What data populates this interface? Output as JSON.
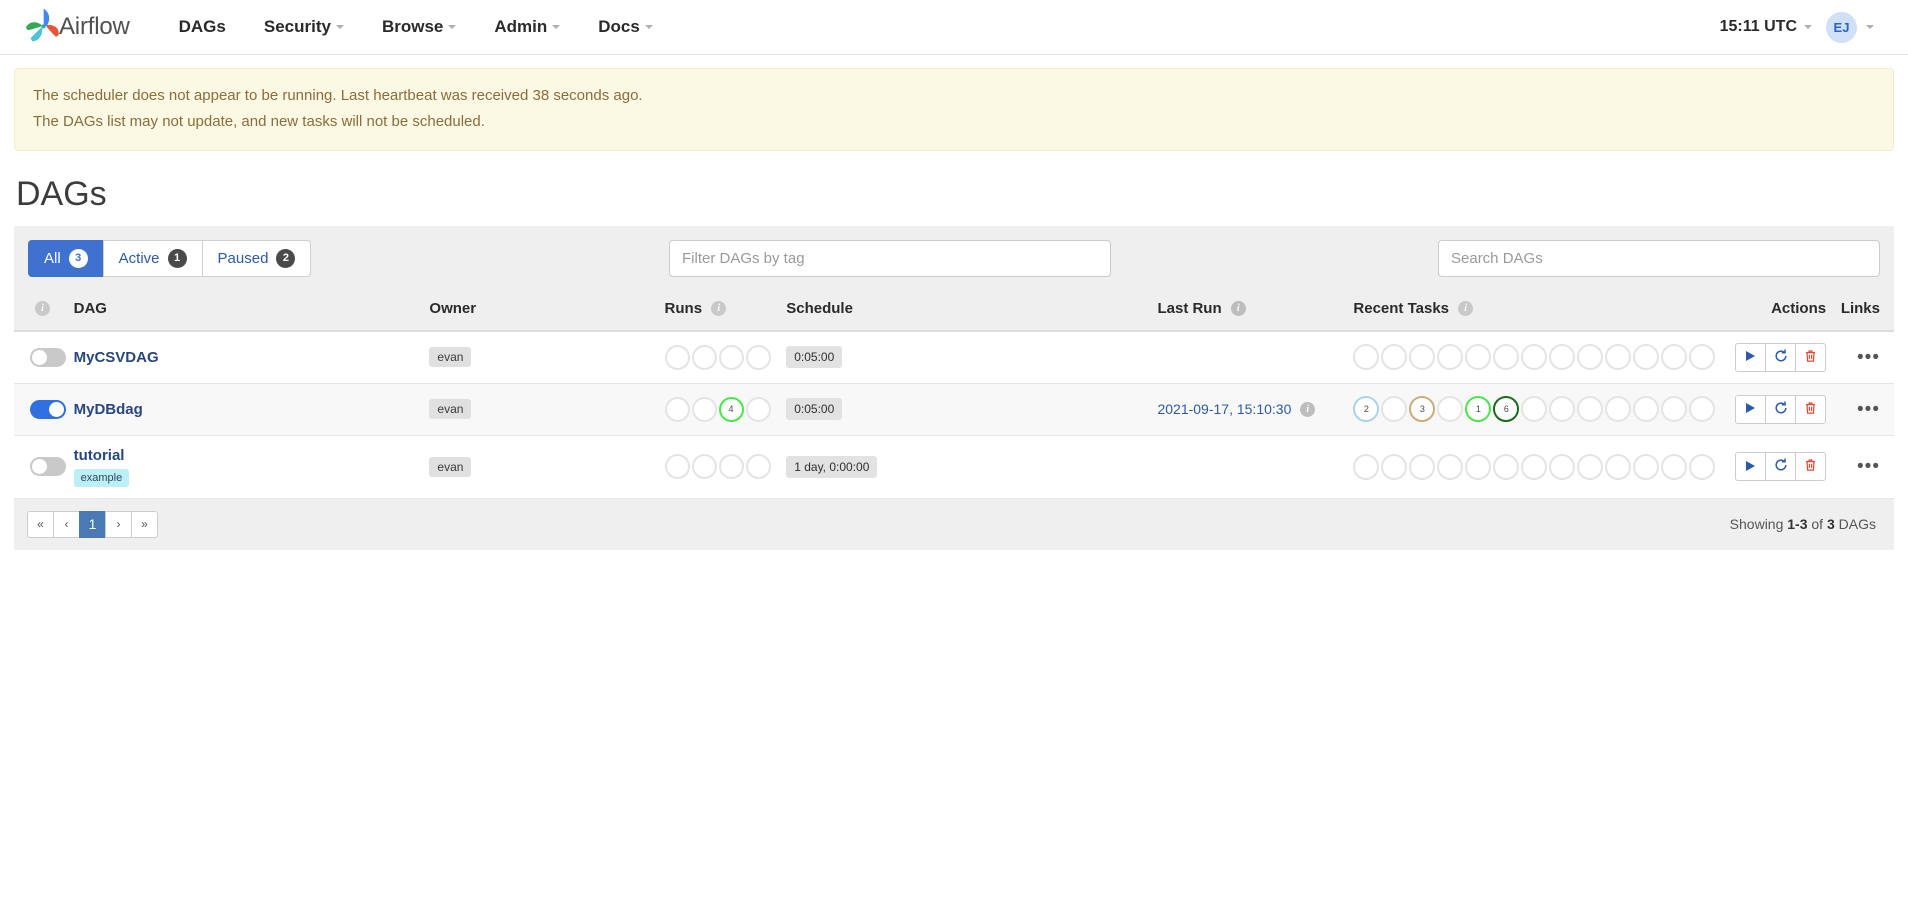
{
  "navbar": {
    "brand": "Airflow",
    "brand_logo_icon": "airflow-pinwheel-logo",
    "links": [
      {
        "label": "DAGs",
        "has_caret": false
      },
      {
        "label": "Security",
        "has_caret": true
      },
      {
        "label": "Browse",
        "has_caret": true
      },
      {
        "label": "Admin",
        "has_caret": true
      },
      {
        "label": "Docs",
        "has_caret": true
      }
    ],
    "clock": "15:11 UTC",
    "avatar_initials": "EJ"
  },
  "alert": {
    "line1": "The scheduler does not appear to be running. Last heartbeat was received 38 seconds ago.",
    "line2": "The DAGs list may not update, and new tasks will not be scheduled."
  },
  "page": {
    "title": "DAGs"
  },
  "filters": {
    "tabs": [
      {
        "label": "All",
        "count": "3",
        "active": true
      },
      {
        "label": "Active",
        "count": "1",
        "active": false
      },
      {
        "label": "Paused",
        "count": "2",
        "active": false
      }
    ],
    "tag_placeholder": "Filter DAGs by tag",
    "tag_value": "",
    "search_placeholder": "Search DAGs",
    "search_value": ""
  },
  "table": {
    "headers": {
      "toggle": "",
      "dag": "DAG",
      "owner": "Owner",
      "runs": "Runs",
      "schedule": "Schedule",
      "last_run": "Last Run",
      "recent_tasks": "Recent Tasks",
      "actions": "Actions",
      "links": "Links"
    },
    "rows": [
      {
        "name": "MyCSVDAG",
        "tag": "",
        "paused": true,
        "owner": "evan",
        "schedule": "0:05:00",
        "last_run": "",
        "runs": [
          {
            "count": "",
            "state": "none"
          },
          {
            "count": "",
            "state": "none"
          },
          {
            "count": "",
            "state": "none"
          },
          {
            "count": "",
            "state": "none"
          }
        ],
        "recent_tasks": [
          {
            "count": "",
            "state": "none"
          },
          {
            "count": "",
            "state": "none"
          },
          {
            "count": "",
            "state": "none"
          },
          {
            "count": "",
            "state": "none"
          },
          {
            "count": "",
            "state": "none"
          },
          {
            "count": "",
            "state": "none"
          },
          {
            "count": "",
            "state": "none"
          },
          {
            "count": "",
            "state": "none"
          },
          {
            "count": "",
            "state": "none"
          },
          {
            "count": "",
            "state": "none"
          },
          {
            "count": "",
            "state": "none"
          },
          {
            "count": "",
            "state": "none"
          },
          {
            "count": "",
            "state": "none"
          }
        ]
      },
      {
        "name": "MyDBdag",
        "tag": "",
        "paused": false,
        "owner": "evan",
        "schedule": "0:05:00",
        "last_run": "2021-09-17, 15:10:30",
        "runs": [
          {
            "count": "",
            "state": "none"
          },
          {
            "count": "",
            "state": "none"
          },
          {
            "count": "4",
            "state": "running"
          },
          {
            "count": "",
            "state": "none"
          }
        ],
        "recent_tasks": [
          {
            "count": "2",
            "state": "scheduled"
          },
          {
            "count": "",
            "state": "none"
          },
          {
            "count": "3",
            "state": "up_for_retry"
          },
          {
            "count": "",
            "state": "none"
          },
          {
            "count": "1",
            "state": "running"
          },
          {
            "count": "6",
            "state": "success"
          },
          {
            "count": "",
            "state": "none"
          },
          {
            "count": "",
            "state": "none"
          },
          {
            "count": "",
            "state": "none"
          },
          {
            "count": "",
            "state": "none"
          },
          {
            "count": "",
            "state": "none"
          },
          {
            "count": "",
            "state": "none"
          },
          {
            "count": "",
            "state": "none"
          }
        ]
      },
      {
        "name": "tutorial",
        "tag": "example",
        "paused": true,
        "owner": "evan",
        "schedule": "1 day, 0:00:00",
        "last_run": "",
        "runs": [
          {
            "count": "",
            "state": "none"
          },
          {
            "count": "",
            "state": "none"
          },
          {
            "count": "",
            "state": "none"
          },
          {
            "count": "",
            "state": "none"
          }
        ],
        "recent_tasks": [
          {
            "count": "",
            "state": "none"
          },
          {
            "count": "",
            "state": "none"
          },
          {
            "count": "",
            "state": "none"
          },
          {
            "count": "",
            "state": "none"
          },
          {
            "count": "",
            "state": "none"
          },
          {
            "count": "",
            "state": "none"
          },
          {
            "count": "",
            "state": "none"
          },
          {
            "count": "",
            "state": "none"
          },
          {
            "count": "",
            "state": "none"
          },
          {
            "count": "",
            "state": "none"
          },
          {
            "count": "",
            "state": "none"
          },
          {
            "count": "",
            "state": "none"
          },
          {
            "count": "",
            "state": "none"
          }
        ]
      }
    ],
    "row_actions": {
      "trigger_icon": "play-icon",
      "refresh_icon": "refresh-icon",
      "delete_icon": "trash-icon",
      "links_icon": "ellipsis-icon"
    }
  },
  "footer": {
    "pager": [
      {
        "label": "«",
        "name": "first",
        "active": false
      },
      {
        "label": "‹",
        "name": "prev",
        "active": false
      },
      {
        "label": "1",
        "name": "page-1",
        "active": true
      },
      {
        "label": "›",
        "name": "next",
        "active": false
      },
      {
        "label": "»",
        "name": "last",
        "active": false
      }
    ],
    "showing_prefix": "Showing ",
    "showing_range": "1-3",
    "showing_mid": " of ",
    "showing_total": "3",
    "showing_suffix": " DAGs"
  },
  "colors": {
    "accent_blue": "#3f72d0",
    "toggle_on": "#2f6fe0",
    "alert_bg": "#fbf8e3",
    "alert_text": "#8a6d3b",
    "state_running": "#4ae64a",
    "state_success": "#1a6b1a",
    "state_scheduled": "#aad4ec",
    "state_up_for_retry": "#cbac7a",
    "state_none": "#e4e4e4",
    "delete_red": "#e8452c",
    "tag_cyan": "#bdeff8"
  }
}
